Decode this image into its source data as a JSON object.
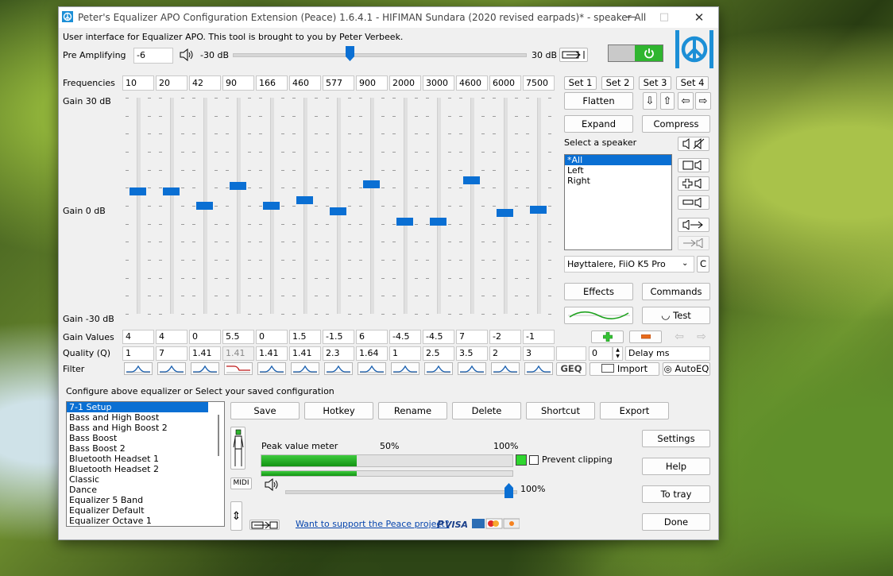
{
  "window": {
    "title": "Peter's Equalizer APO Configuration Extension (Peace) 1.6.4.1 - HIFIMAN Sundara (2020 revised earpads)* - speaker All"
  },
  "header": {
    "description": "User interface for Equalizer APO. This tool is brought to you by Peter Verbeek.",
    "pre_amp_label": "Pre Amplifying",
    "pre_amp_value": "-6",
    "pre_amp_min": "-30 dB",
    "pre_amp_max": "30 dB"
  },
  "eq": {
    "frequencies_label": "Frequencies",
    "gain_top": "Gain 30 dB",
    "gain_mid": "Gain 0 dB",
    "gain_bottom": "Gain -30 dB",
    "gain_values_label": "Gain Values",
    "quality_label": "Quality (Q)",
    "filter_label": "Filter",
    "bands": [
      {
        "freq": "10",
        "gain": "4",
        "q": "1",
        "filter": "peak"
      },
      {
        "freq": "20",
        "gain": "4",
        "q": "7",
        "filter": "peak"
      },
      {
        "freq": "42",
        "gain": "0",
        "q": "1.41",
        "filter": "peak"
      },
      {
        "freq": "90",
        "gain": "5.5",
        "q": "1.41",
        "filter": "lowshelf"
      },
      {
        "freq": "166",
        "gain": "0",
        "q": "1.41",
        "filter": "peak"
      },
      {
        "freq": "460",
        "gain": "1.5",
        "q": "1.41",
        "filter": "peak"
      },
      {
        "freq": "577",
        "gain": "-1.5",
        "q": "2.3",
        "filter": "peak"
      },
      {
        "freq": "900",
        "gain": "6",
        "q": "1.64",
        "filter": "peak"
      },
      {
        "freq": "2000",
        "gain": "-4.5",
        "q": "1",
        "filter": "peak"
      },
      {
        "freq": "3000",
        "gain": "-4.5",
        "q": "2.5",
        "filter": "peak"
      },
      {
        "freq": "4600",
        "gain": "7",
        "q": "3.5",
        "filter": "peak"
      },
      {
        "freq": "6000",
        "gain": "-2",
        "q": "2",
        "filter": "peak"
      },
      {
        "freq": "7500",
        "gain": "-1",
        "q": "3",
        "filter": "peak"
      }
    ],
    "delay_value": "0",
    "delay_label": "Delay ms"
  },
  "right_panel": {
    "sets": [
      "Set 1",
      "Set 2",
      "Set 3",
      "Set 4"
    ],
    "flatten": "Flatten",
    "expand": "Expand",
    "compress": "Compress",
    "select_speaker_label": "Select a speaker",
    "speakers": [
      "*All",
      "Left",
      "Right"
    ],
    "device": "Høyttalere, FiiO K5 Pro",
    "device_c": "C",
    "effects": "Effects",
    "commands": "Commands",
    "test": "Test",
    "geq": "GEQ",
    "import": "Import",
    "autoeq": "AutoEQ"
  },
  "config": {
    "label": "Configure above equalizer or Select your saved configuration",
    "items": [
      "7-1 Setup",
      "Bass and High Boost",
      "Bass and High Boost 2",
      "Bass Boost",
      "Bass Boost 2",
      "Bluetooth Headset 1",
      "Bluetooth Headset 2",
      "Classic",
      "Dance",
      "Equalizer 5 Band",
      "Equalizer Default",
      "Equalizer Octave 1"
    ],
    "save": "Save",
    "hotkey": "Hotkey",
    "rename": "Rename",
    "delete": "Delete",
    "shortcut": "Shortcut",
    "export": "Export",
    "midi": "MIDI"
  },
  "meter": {
    "label": "Peak value meter",
    "fifty": "50%",
    "hundred": "100%",
    "prevent_clipping": "Prevent clipping",
    "volume_value": "100%",
    "peak_level": 0.38,
    "peak_level_2": 0.38
  },
  "footer": {
    "support_link": "Want to support the Peace project?",
    "settings": "Settings",
    "help": "Help",
    "to_tray": "To tray",
    "done": "Done"
  },
  "colors": {
    "accent": "#0a6fd3",
    "power_green": "#2fb52f",
    "meter_green": "#1fa11f"
  }
}
